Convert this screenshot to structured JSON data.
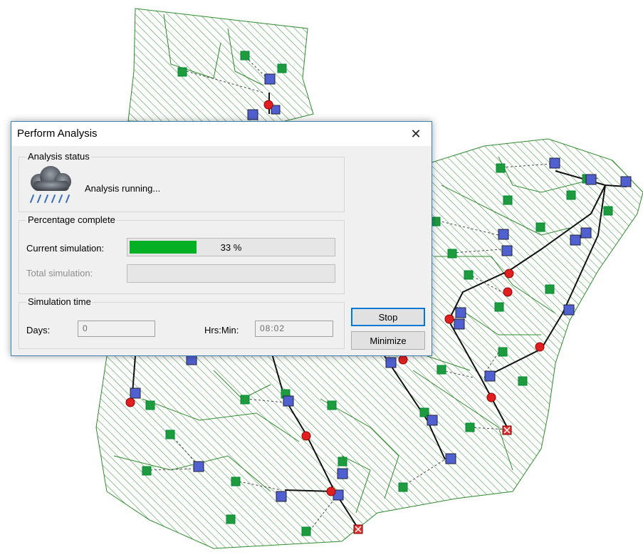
{
  "dialog": {
    "title": "Perform Analysis",
    "close_glyph": "✕",
    "status_group": {
      "legend": "Analysis status",
      "icon": "rain-cloud-icon",
      "message": "Analysis running..."
    },
    "percentage_group": {
      "legend": "Percentage complete",
      "current_label": "Current simulation:",
      "current_percent": 33,
      "current_text": "33 %",
      "total_label": "Total simulation:"
    },
    "time_group": {
      "legend": "Simulation time",
      "days_label": "Days:",
      "days_value": "0",
      "hrsmin_label": "Hrs:Min:",
      "hrsmin_value": "08:02"
    },
    "buttons": {
      "stop": "Stop",
      "minimize": "Minimize"
    }
  },
  "map": {
    "hatch_color": "#2e8b2e",
    "node_colors": {
      "subcatchment": "#1e9b3e",
      "storage": "#5060d0",
      "junction": "#e02020",
      "outfall": "#e03030"
    }
  }
}
